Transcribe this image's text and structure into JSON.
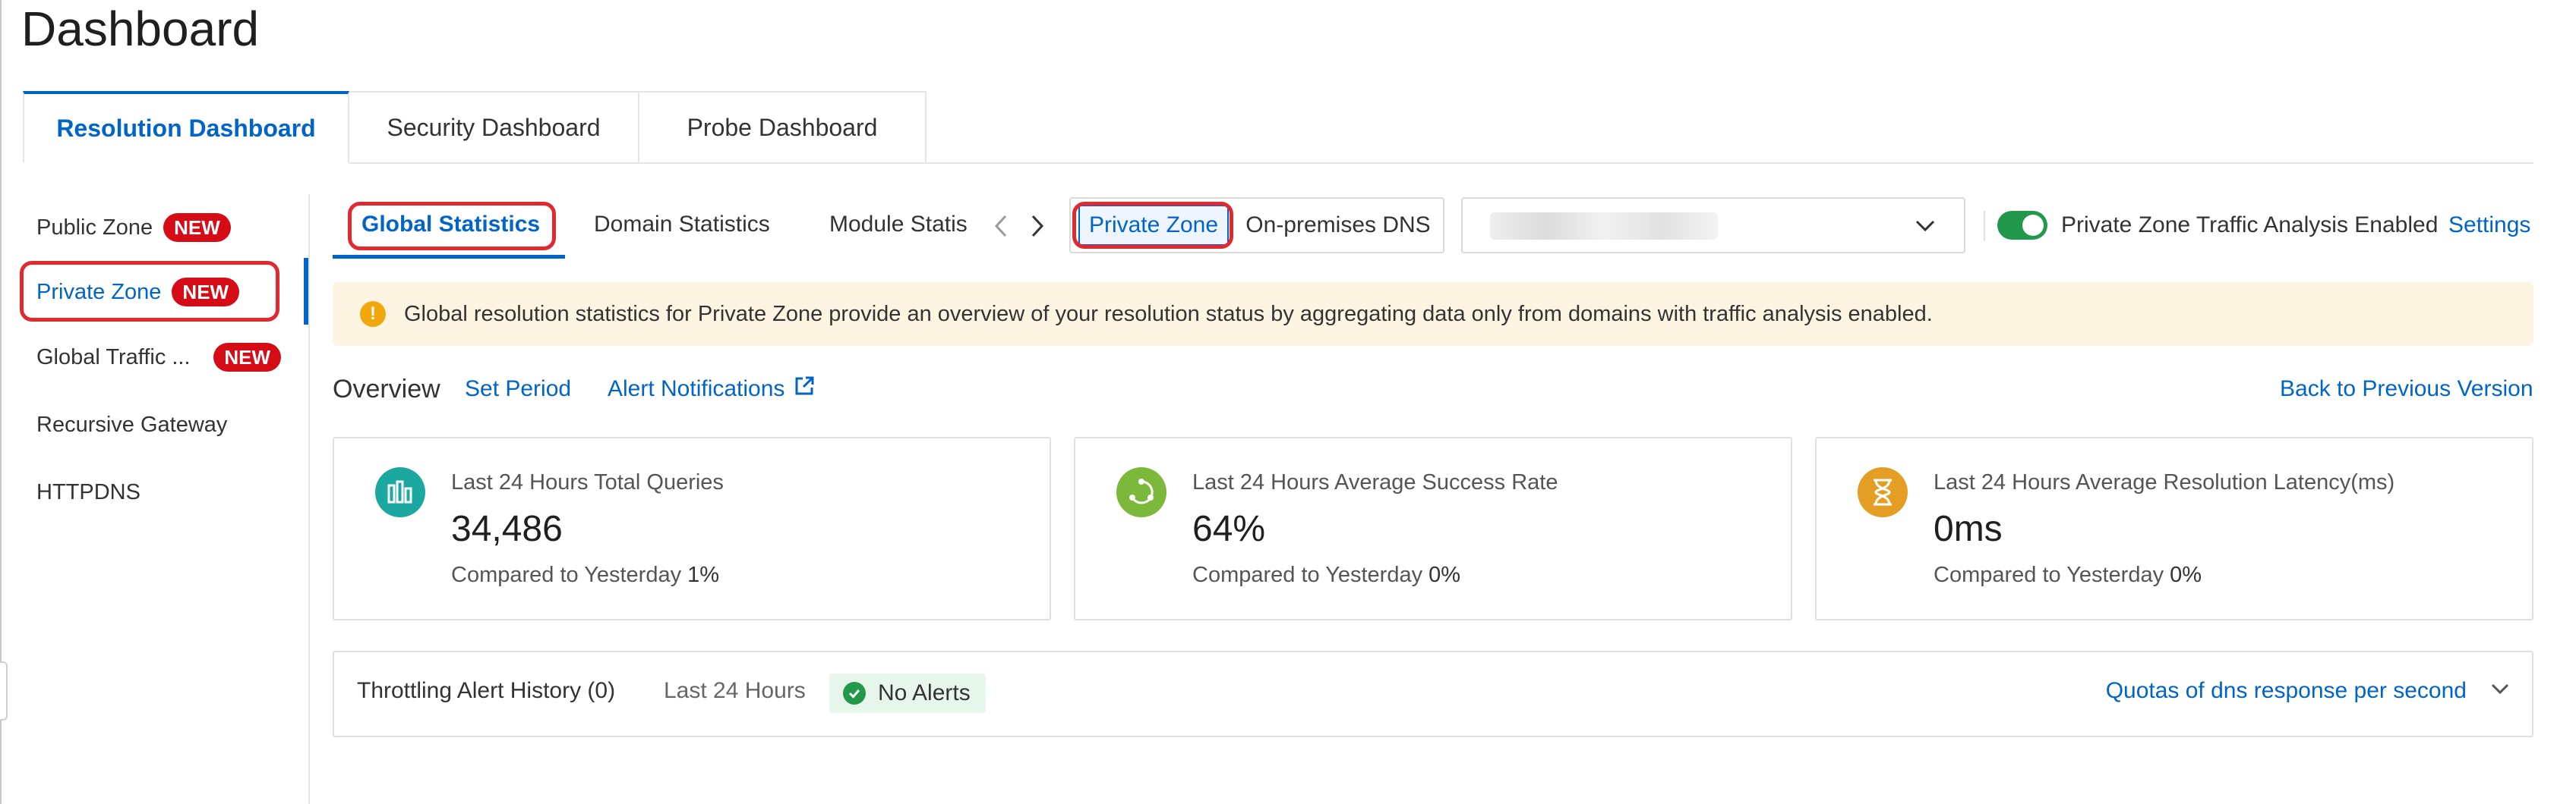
{
  "page": {
    "title": "Dashboard"
  },
  "top_tabs": [
    {
      "label": "Resolution Dashboard",
      "active": true
    },
    {
      "label": "Security Dashboard",
      "active": false
    },
    {
      "label": "Probe Dashboard",
      "active": false
    }
  ],
  "sidebar": {
    "items": [
      {
        "label": "Public Zone",
        "badge": "NEW"
      },
      {
        "label": "Private Zone",
        "badge": "NEW",
        "active": true
      },
      {
        "label": "Global Traffic ...",
        "badge": "NEW"
      },
      {
        "label": "Recursive Gateway"
      },
      {
        "label": "HTTPDNS"
      }
    ]
  },
  "sub_tabs": [
    {
      "label": "Global Statistics",
      "active": true
    },
    {
      "label": "Domain Statistics"
    },
    {
      "label": "Module Statis"
    }
  ],
  "zone_switch": {
    "options": [
      "Private Zone",
      "On-premises DNS"
    ],
    "selected": "Private Zone"
  },
  "toggle": {
    "label": "Private Zone Traffic Analysis Enabled",
    "on": true,
    "settings_label": "Settings"
  },
  "banner": {
    "icon": "warning-icon",
    "text": "Global resolution statistics for Private Zone provide an overview of your resolution status by aggregating data only from domains with traffic analysis enabled."
  },
  "overview": {
    "title": "Overview",
    "set_period": "Set Period",
    "alert_notifications": "Alert Notifications",
    "back_link": "Back to Previous Version"
  },
  "cards": [
    {
      "icon": "bar-chart-icon",
      "color": "#1ba8a0",
      "label": "Last 24 Hours Total Queries",
      "value": "34,486",
      "compare_label": "Compared to Yesterday",
      "compare_value": "1%"
    },
    {
      "icon": "cycle-icon",
      "color": "#7cb83a",
      "label": "Last 24 Hours Average Success Rate",
      "value": "64%",
      "compare_label": "Compared to Yesterday",
      "compare_value": "0%"
    },
    {
      "icon": "hourglass-icon",
      "color": "#e39e23",
      "label": "Last 24 Hours Average Resolution Latency(ms)",
      "value": "0ms",
      "compare_label": "Compared to Yesterday",
      "compare_value": "0%"
    }
  ],
  "throttling": {
    "title": "Throttling Alert History (0)",
    "period": "Last 24 Hours",
    "status": "No Alerts",
    "link": "Quotas of dns response per second"
  },
  "colors": {
    "accent": "#0064c8",
    "badge": "#d50b16",
    "success": "#22994a",
    "banner_bg": "#fdf5e1"
  }
}
